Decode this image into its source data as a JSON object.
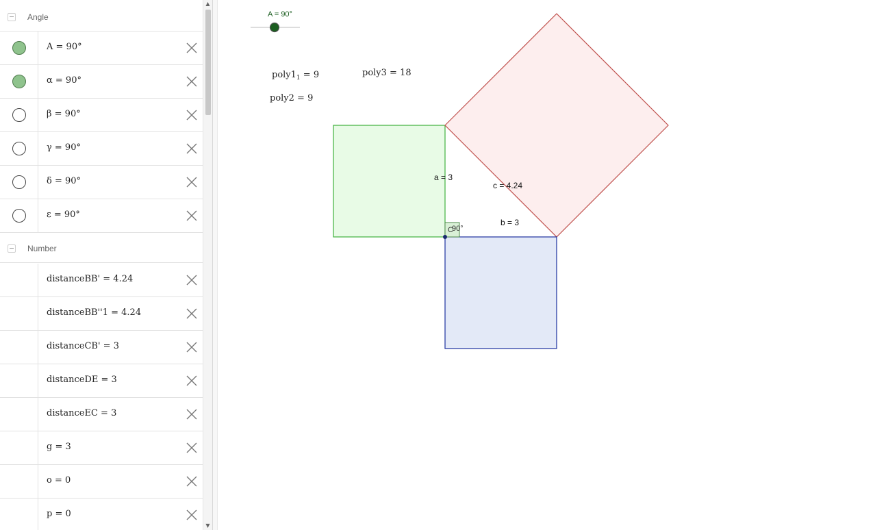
{
  "algebra": {
    "groups": [
      {
        "label": "Angle",
        "rows": [
          {
            "expr": "A = 90°",
            "visible": true
          },
          {
            "expr": "α = 90°",
            "visible": true
          },
          {
            "expr": "β = 90°",
            "visible": false
          },
          {
            "expr": "γ = 90°",
            "visible": false
          },
          {
            "expr": "δ = 90°",
            "visible": false
          },
          {
            "expr": "ε = 90°",
            "visible": false
          }
        ]
      },
      {
        "label": "Number",
        "rows": [
          {
            "expr": "distanceBB' = 4.24"
          },
          {
            "expr": "distanceBB''1 = 4.24"
          },
          {
            "expr": "distanceCB' = 3"
          },
          {
            "expr": "distanceDE = 3"
          },
          {
            "expr": "distanceEC = 3"
          },
          {
            "expr": "g = 3"
          },
          {
            "expr": "o = 0"
          },
          {
            "expr": "p = 0"
          }
        ]
      }
    ]
  },
  "graphics": {
    "slider_label": "A = 90°",
    "text_poly1_name": "poly1",
    "text_poly1_sub": "1",
    "text_poly1_value": " = 9",
    "text_poly2": "poly2 = 9",
    "text_poly3": "poly3 = 18",
    "label_a": "a = 3",
    "label_b": "b = 3",
    "label_c": "c = 4.24",
    "label_point_c": "C",
    "label_angle": "90°",
    "colors": {
      "green_fill": "#e8fbe6",
      "green_stroke": "#3fb13c",
      "pink_fill": "#fdeeee",
      "pink_stroke": "#c0504d",
      "blue_fill": "#e3e9f7",
      "blue_stroke": "#1c2f9e",
      "slider_green": "#1b5e20"
    }
  }
}
